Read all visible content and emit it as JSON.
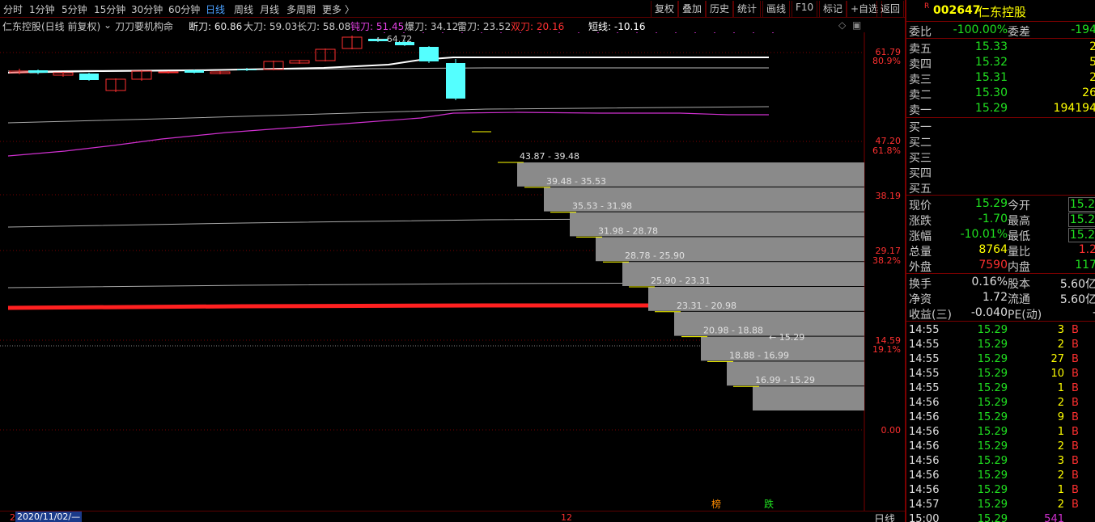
{
  "toolbar": {
    "periods": [
      "分时",
      "1分钟",
      "5分钟",
      "15分钟",
      "30分钟",
      "60分钟",
      "日线",
      "周线",
      "月线",
      "多周期",
      "更多 〉"
    ],
    "active_period": "日线",
    "right_buttons": [
      "复权",
      "叠加",
      "历史",
      "统计",
      "画线",
      "F10",
      "标记",
      "+自选",
      "返回"
    ]
  },
  "indicator": {
    "stock_title": "仁东控股(日线 前复权)",
    "formula": "刀刀要机构命",
    "items": [
      {
        "label": "断刀: 60.86",
        "color": "#e8e8e8"
      },
      {
        "label": "大刀: 59.03",
        "color": "#c8c8c8"
      },
      {
        "label": "长刀: 58.08",
        "color": "#c8c8c8"
      },
      {
        "label": "钝刀: 51.45",
        "color": "#e040e0"
      },
      {
        "label": "爆刀: 34.12",
        "color": "#c8c8c8"
      },
      {
        "label": "雷刀: 23.52",
        "color": "#c8c8c8"
      },
      {
        "label": "双刀: 20.16",
        "color": "#ff3030"
      },
      {
        "label": "短线: -10.16",
        "color": "#ffffff"
      }
    ]
  },
  "axis": {
    "right_labels": [
      {
        "price": "61.79",
        "pct": "80.9%"
      },
      {
        "price": "47.20",
        "pct": "61.8%"
      },
      {
        "price": "38.19",
        "pct": ""
      },
      {
        "price": "29.17",
        "pct": "38.2%"
      },
      {
        "price": "14.59",
        "pct": "19.1%"
      },
      {
        "price": "0.00",
        "pct": ""
      }
    ]
  },
  "chart_labels": {
    "peak_label": "64.72",
    "bottom_label": "15.29"
  },
  "price_ranges": [
    "43.87 - 39.48",
    "39.48 - 35.53",
    "35.53 - 31.98",
    "31.98 - 28.78",
    "28.78 - 25.90",
    "25.90 - 23.31",
    "23.31 - 20.98",
    "20.98 - 18.88",
    "18.88 - 16.99",
    "16.99 - 15.29"
  ],
  "bottom": {
    "date": "2020/11/02/—",
    "prefix": "2",
    "month_marker": "12",
    "period_label": "日线",
    "marker_1": "榜",
    "marker_2": "跌"
  },
  "quote": {
    "badge": "R",
    "code": "002647",
    "name": "仁东控股",
    "weibi_label": "委比",
    "weibi": "-100.00%",
    "weicha_label": "委差",
    "weicha": "-194",
    "asks": [
      {
        "label": "卖五",
        "price": "15.33",
        "vol": "2"
      },
      {
        "label": "卖四",
        "price": "15.32",
        "vol": "5"
      },
      {
        "label": "卖三",
        "price": "15.31",
        "vol": "2"
      },
      {
        "label": "卖二",
        "price": "15.30",
        "vol": "26"
      },
      {
        "label": "卖一",
        "price": "15.29",
        "vol": "194194"
      }
    ],
    "bids": [
      "买一",
      "买二",
      "买三",
      "买四",
      "买五"
    ],
    "stats": [
      {
        "l1": "现价",
        "v1": "15.29",
        "c1": "#20e020",
        "l2": "今开",
        "v2": "15.2",
        "c2": "#20e020"
      },
      {
        "l1": "涨跌",
        "v1": "-1.70",
        "c1": "#20e020",
        "l2": "最高",
        "v2": "15.2",
        "c2": "#20e020"
      },
      {
        "l1": "涨幅",
        "v1": "-10.01%",
        "c1": "#20e020",
        "l2": "最低",
        "v2": "15.2",
        "c2": "#20e020"
      },
      {
        "l1": "总量",
        "v1": "8764",
        "c1": "#ffff00",
        "l2": "量比",
        "v2": "1.2",
        "c2": "#ff3030"
      },
      {
        "l1": "外盘",
        "v1": "7590",
        "c1": "#ff3030",
        "l2": "内盘",
        "v2": "117",
        "c2": "#20e020"
      }
    ],
    "finance": [
      {
        "l1": "换手",
        "v1": "0.16%",
        "l2": "股本",
        "v2": "5.60亿"
      },
      {
        "l1": "净资",
        "v1": "1.72",
        "l2": "流通",
        "v2": "5.60亿"
      },
      {
        "l1": "收益(三)",
        "v1": "-0.040",
        "l2": "PE(动)",
        "v2": "-"
      }
    ],
    "ticks": [
      {
        "time": "14:55",
        "price": "15.29",
        "vol": "3",
        "side": "B"
      },
      {
        "time": "14:55",
        "price": "15.29",
        "vol": "2",
        "side": "B"
      },
      {
        "time": "14:55",
        "price": "15.29",
        "vol": "27",
        "side": "B"
      },
      {
        "time": "14:55",
        "price": "15.29",
        "vol": "10",
        "side": "B"
      },
      {
        "time": "14:55",
        "price": "15.29",
        "vol": "1",
        "side": "B"
      },
      {
        "time": "14:56",
        "price": "15.29",
        "vol": "2",
        "side": "B"
      },
      {
        "time": "14:56",
        "price": "15.29",
        "vol": "9",
        "side": "B"
      },
      {
        "time": "14:56",
        "price": "15.29",
        "vol": "1",
        "side": "B"
      },
      {
        "time": "14:56",
        "price": "15.29",
        "vol": "2",
        "side": "B"
      },
      {
        "time": "14:56",
        "price": "15.29",
        "vol": "3",
        "side": "B"
      },
      {
        "time": "14:56",
        "price": "15.29",
        "vol": "2",
        "side": "B"
      },
      {
        "time": "14:56",
        "price": "15.29",
        "vol": "1",
        "side": "B"
      },
      {
        "time": "14:57",
        "price": "15.29",
        "vol": "2",
        "side": "B"
      },
      {
        "time": "15:00",
        "price": "15.29",
        "vol": "541",
        "side": ""
      }
    ]
  },
  "colors": {
    "up": "#ff3030",
    "down": "#54ffff",
    "green": "#20e020",
    "grid": "#7a0000",
    "profile_bar": "#8a8a8a",
    "magenta": "#d030d0"
  }
}
